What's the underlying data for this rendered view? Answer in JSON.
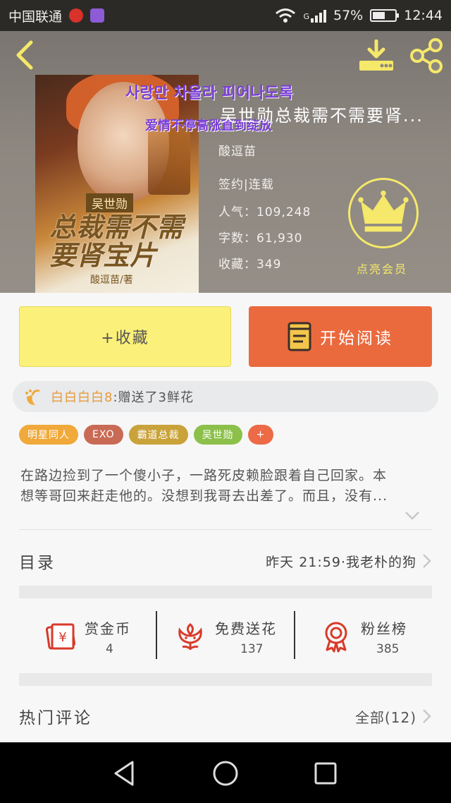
{
  "status_bar": {
    "carrier": "中国联通",
    "network": "G",
    "battery_text": "57%",
    "battery_level": 0.57,
    "time": "12:44"
  },
  "book": {
    "title": "吴世勋总裁需不需要肾...",
    "author": "酸逗苗",
    "status": "签约|连载",
    "popularity": "人气：109,248",
    "word_count": "字数：61,930",
    "favorites": "收藏：349",
    "vip_label": "点亮会员"
  },
  "cover": {
    "korean_overlay": "사랑만 차올라 피어나도록",
    "chinese_overlay": "爱情不停高涨直到绽放",
    "name_tag": "吴世勋",
    "big_title": "总裁需不需要肾宝片",
    "author_line": "酸逗苗/著"
  },
  "actions": {
    "favorite_label": "+收藏",
    "read_label": "开始阅读"
  },
  "gift": {
    "user": "白白白白8",
    "text": ":赠送了3鲜花"
  },
  "tags": [
    {
      "label": "明星同人",
      "color": "#f0a93a"
    },
    {
      "label": "EXO",
      "color": "#c96a55"
    },
    {
      "label": "霸道总裁",
      "color": "#c9a23a"
    },
    {
      "label": "吴世勋",
      "color": "#8cc04a"
    },
    {
      "label": "+",
      "color": "#ec6a45"
    }
  ],
  "description": {
    "line1": "在路边捡到了一个傻小子，一路死皮赖脸跟着自己回家。本",
    "line2": "想等哥回来赶走他的。没想到我哥去出差了。而且，没有..."
  },
  "catalog": {
    "label": "目录",
    "latest": "昨天 21:59·我老朴的狗"
  },
  "stats": [
    {
      "name": "赏金币",
      "value": "4"
    },
    {
      "name": "免费送花",
      "value": "137"
    },
    {
      "name": "粉丝榜",
      "value": "385"
    }
  ],
  "comments": {
    "label": "热门评论",
    "all": "全部(12)"
  },
  "colors": {
    "accent_red": "#d83a2a",
    "read_button": "#ea6a3e",
    "favorite_button": "#fbf07a",
    "vip_gold": "#f5e86a"
  }
}
